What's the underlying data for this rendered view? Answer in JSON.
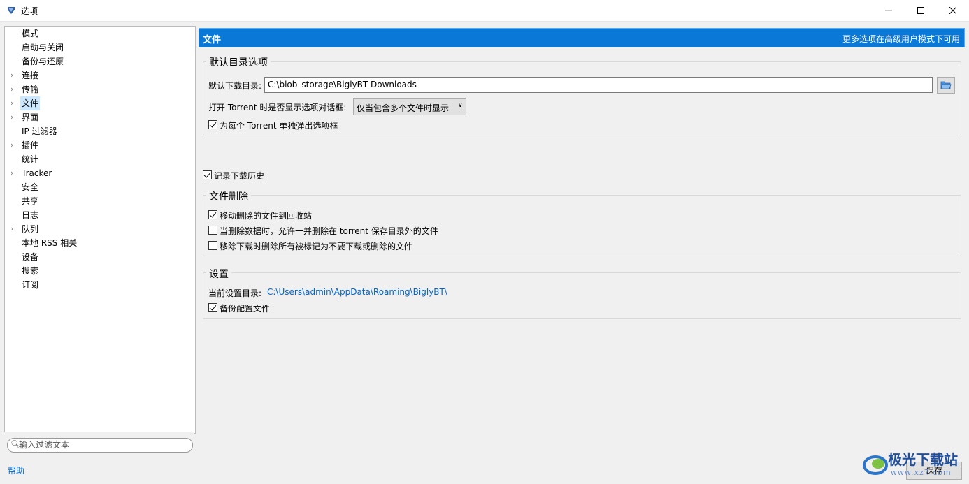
{
  "window": {
    "title": "选项"
  },
  "tree": {
    "items": [
      {
        "label": "模式",
        "arrow": false
      },
      {
        "label": "启动与关闭",
        "arrow": false
      },
      {
        "label": "备份与还原",
        "arrow": false
      },
      {
        "label": "连接",
        "arrow": true
      },
      {
        "label": "传输",
        "arrow": true
      },
      {
        "label": "文件",
        "arrow": true,
        "selected": true
      },
      {
        "label": "界面",
        "arrow": true
      },
      {
        "label": "IP 过滤器",
        "arrow": false
      },
      {
        "label": "插件",
        "arrow": true
      },
      {
        "label": "统计",
        "arrow": false
      },
      {
        "label": "Tracker",
        "arrow": true
      },
      {
        "label": "安全",
        "arrow": false
      },
      {
        "label": "共享",
        "arrow": false
      },
      {
        "label": "日志",
        "arrow": false
      },
      {
        "label": "队列",
        "arrow": true
      },
      {
        "label": "本地 RSS 相关",
        "arrow": false
      },
      {
        "label": "设备",
        "arrow": false
      },
      {
        "label": "搜索",
        "arrow": false
      },
      {
        "label": "订阅",
        "arrow": false
      }
    ],
    "filter_placeholder": "输入过滤文本"
  },
  "help_label": "帮助",
  "header": {
    "title": "文件",
    "note": "更多选项在高级用户模式下可用"
  },
  "default_dir": {
    "group_title": "默认目录选项",
    "dir_label": "默认下载目录:",
    "dir_value": "C:\\blob_storage\\BiglyBT Downloads",
    "dialog_label": "打开 Torrent 时是否显示选项对话框:",
    "dialog_value": "仅当包含多个文件时显示",
    "popup_label": "为每个 Torrent 单独弹出选项框",
    "popup_checked": true
  },
  "history": {
    "label": "记录下载历史",
    "checked": true
  },
  "file_delete": {
    "group_title": "文件删除",
    "opt1": "移动删除的文件到回收站",
    "opt1_checked": true,
    "opt2": "当删除数据时，允许一并删除在 torrent 保存目录外的文件",
    "opt2_checked": false,
    "opt3": "移除下载时删除所有被标记为不要下载或删除的文件",
    "opt3_checked": false
  },
  "settings": {
    "group_title": "设置",
    "dir_label": "当前设置目录:",
    "dir_value": "C:\\Users\\admin\\AppData\\Roaming\\BiglyBT\\",
    "backup_label": "备份配置文件",
    "backup_checked": true
  },
  "save_label": "保存",
  "watermark": {
    "text": "极光下载站",
    "sub": "www.xz7.com"
  }
}
